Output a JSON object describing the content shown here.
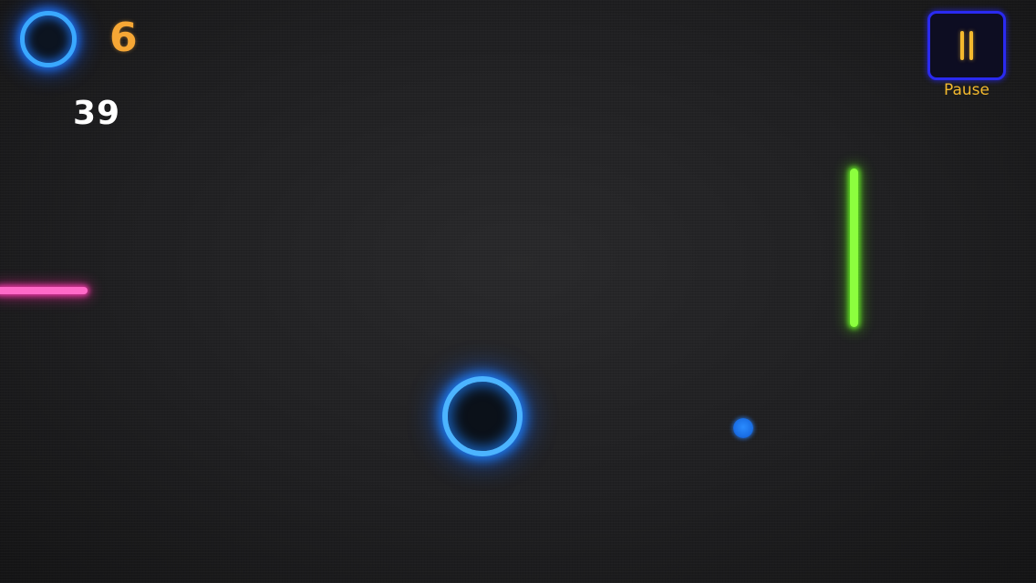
{
  "hud": {
    "lives_icon": "ring-icon",
    "lives_count": "6",
    "score": "39"
  },
  "pause": {
    "icon": "pause-icon",
    "label": "Pause"
  },
  "game_objects": {
    "player": "blue-neon-ring",
    "ball": "blue-dot",
    "left_bar": "pink-neon-bar",
    "right_bar": "green-neon-bar"
  },
  "colors": {
    "background": "#1f1f21",
    "ring_blue": "#3aa8ff",
    "lives_orange": "#f6a735",
    "pause_border": "#2a2af0",
    "pause_yellow": "#f3b92e",
    "pink_bar": "#ff69c8",
    "green_bar": "#8cff3e",
    "ball_blue": "#1a6fe6"
  }
}
